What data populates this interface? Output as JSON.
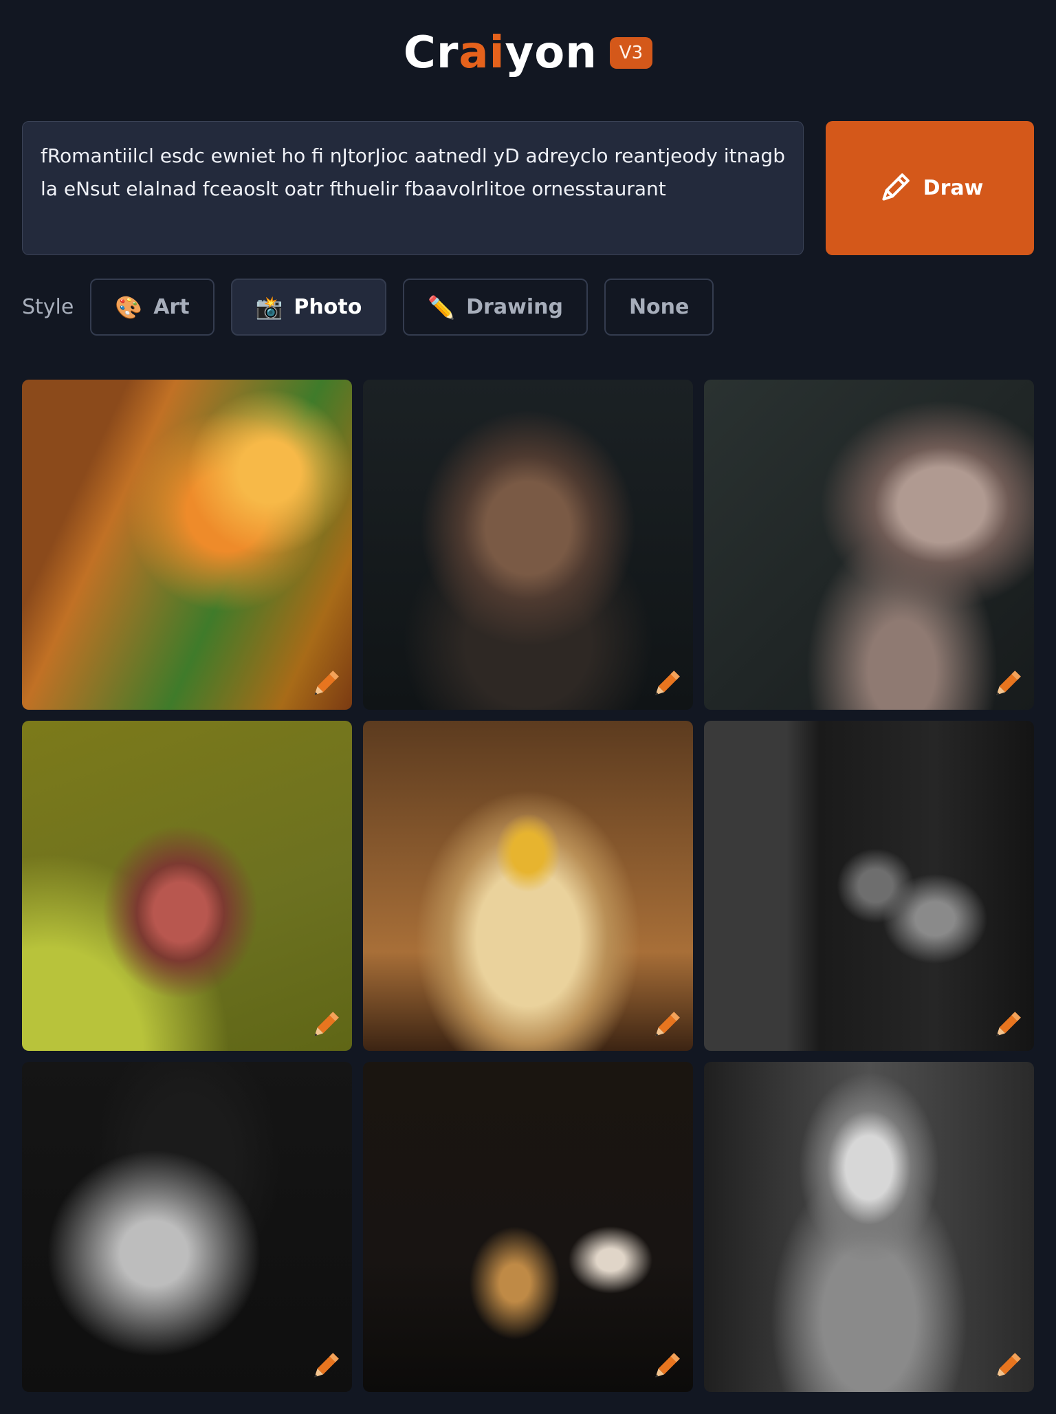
{
  "header": {
    "logo_text_start": "Cr",
    "logo_text_accent": "ai",
    "logo_text_end": "yon",
    "version_badge": "V3",
    "accent_color": "#d4581a"
  },
  "prompt": {
    "value": "fRomantiilcl esdc ewniet ho fi nJtorJioc aatnedl yD adreyclo reantjeody itnagb la eNsut elalnad fceaoslt oatr fthuelir fbaavolrlitoe ornesstaurant"
  },
  "draw_button": {
    "label": "Draw",
    "icon": "pencil-icon"
  },
  "style_selector": {
    "label": "Style",
    "options": [
      {
        "label": "Art",
        "icon": "palette-icon",
        "glyph": "🎨",
        "active": false
      },
      {
        "label": "Photo",
        "icon": "camera-flash-icon",
        "glyph": "📸",
        "active": true
      },
      {
        "label": "Drawing",
        "icon": "pencil-icon",
        "glyph": "✏️",
        "active": false
      },
      {
        "label": "None",
        "icon": "",
        "glyph": "",
        "active": false
      }
    ]
  },
  "results": {
    "images": [
      {
        "subject": "tree-frog-macro",
        "edit_icon": "pencil-icon"
      },
      {
        "subject": "dog-portrait",
        "edit_icon": "pencil-icon"
      },
      {
        "subject": "woman-profile",
        "edit_icon": "pencil-icon"
      },
      {
        "subject": "ant-macro",
        "edit_icon": "pencil-icon"
      },
      {
        "subject": "finch-bird",
        "edit_icon": "pencil-icon"
      },
      {
        "subject": "bw-men-doorway",
        "edit_icon": "pencil-icon"
      },
      {
        "subject": "bw-woman-portrait",
        "edit_icon": "pencil-icon"
      },
      {
        "subject": "sailboat-night",
        "edit_icon": "pencil-icon"
      },
      {
        "subject": "bw-woman-draped",
        "edit_icon": "pencil-icon"
      }
    ]
  }
}
